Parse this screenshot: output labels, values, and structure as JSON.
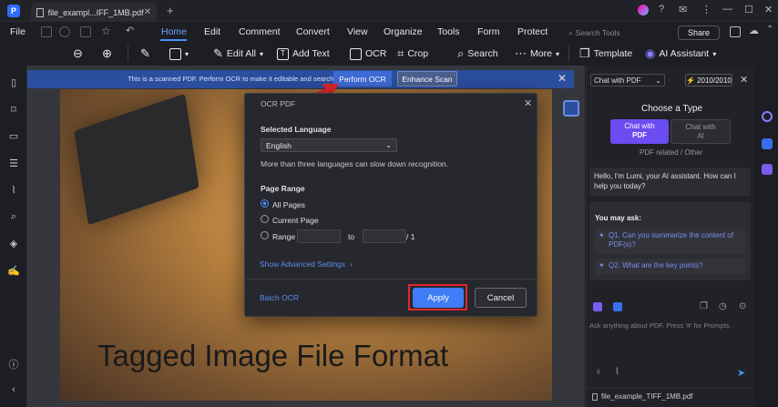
{
  "titlebar": {
    "tab_title": "file_exampl...IFF_1MB.pdf",
    "tab_close": "✕",
    "new_tab": "+",
    "controls": [
      "☺",
      "?",
      "✉",
      "⋮",
      "—",
      "☐",
      "✕"
    ]
  },
  "menubar": {
    "file": "File",
    "items": [
      "Home",
      "Edit",
      "Comment",
      "Convert",
      "View",
      "Organize",
      "Tools",
      "Form",
      "Protect"
    ],
    "search_placeholder": "Search Tools",
    "share": "Share"
  },
  "toolbar": {
    "edit_all": "Edit All",
    "add_text": "Add Text",
    "ocr": "OCR",
    "crop": "Crop",
    "search": "Search",
    "more": "More",
    "template": "Template",
    "ai_assistant": "AI Assistant"
  },
  "banner": {
    "text": "This is a scanned PDF. Perform OCR to make it editable and searchable.",
    "perform_ocr": "Perform OCR",
    "enhance_scan": "Enhance Scan"
  },
  "page": {
    "heading": "Tagged Image File Format"
  },
  "dialog": {
    "title": "OCR PDF",
    "selected_language_label": "Selected Language",
    "language_value": "English",
    "language_note": "More than three languages can slow down recognition.",
    "page_range_label": "Page Range",
    "all_pages": "All Pages",
    "current_page": "Current Page",
    "range": "Range",
    "to": "to",
    "of_total": "/ 1",
    "advanced_settings": "Show Advanced Settings",
    "batch_ocr": "Batch OCR",
    "apply": "Apply",
    "cancel": "Cancel",
    "selected_page_range": "All Pages"
  },
  "ai_panel": {
    "mode_select": "Chat with PDF",
    "credits": "2010/2010",
    "choose_type": "Choose a Type",
    "chat_with_pdf_line1": "Chat with",
    "chat_with_pdf_line2": "PDF",
    "chat_with_ai_line1": "Chat with",
    "chat_with_ai_line2": "AI",
    "category": "PDF related / Other",
    "greeting": "Hello, I'm Lumi, your AI assistant. How can I help you today?",
    "you_may_ask": "You may ask:",
    "q1": "Q1. Can you summarize the content of PDF(s)?",
    "q2": "Q2. What are the key points?",
    "input_placeholder": "Ask anything about PDF. Press '#' for Prompts.",
    "filename": "file_example_TIFF_1MB.pdf"
  },
  "colors": {
    "accent": "#4c8dff",
    "highlight_red": "#e0262e",
    "ai_purple": "#6a4cf0"
  }
}
